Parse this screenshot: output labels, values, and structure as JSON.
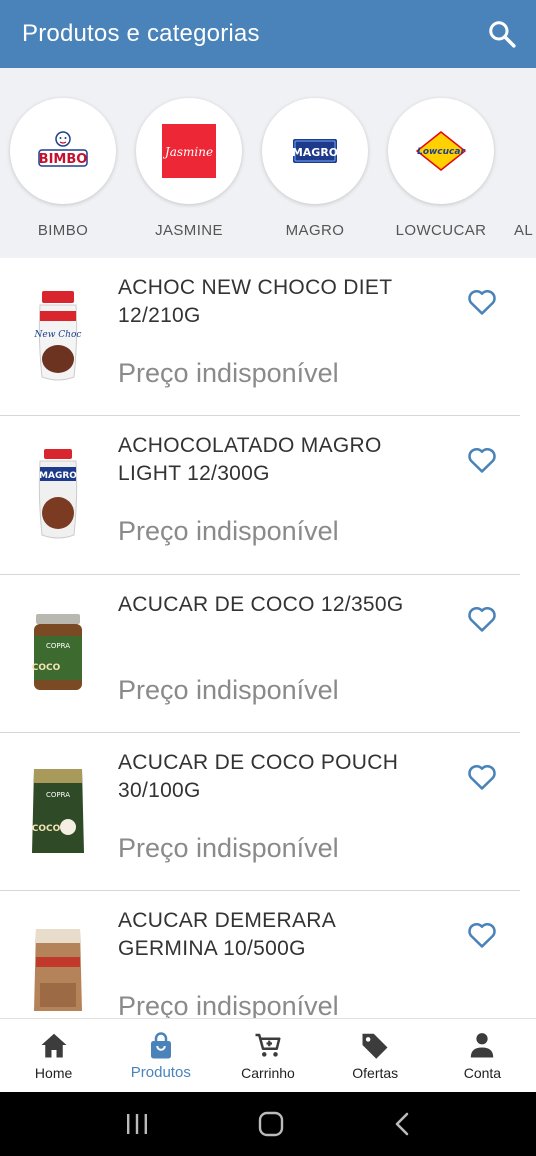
{
  "header": {
    "title": "Produtos e categorias",
    "search_icon": "search-icon"
  },
  "brands": [
    {
      "label": "BIMBO",
      "logo_text": "BIMBO"
    },
    {
      "label": "JASMINE",
      "logo_text": "Jasmine"
    },
    {
      "label": "MAGRO",
      "logo_text": "MAGRO"
    },
    {
      "label": "LOWCUCAR",
      "logo_text": "Lowcucar"
    },
    {
      "label": "AL"
    }
  ],
  "products": [
    {
      "name": "ACHOC NEW CHOCO DIET 12/210G",
      "price": "Preço indisponível"
    },
    {
      "name": "ACHOCOLATADO MAGRO LIGHT 12/300G",
      "price": "Preço indisponível"
    },
    {
      "name": "ACUCAR DE COCO 12/350G",
      "price": "Preço indisponível"
    },
    {
      "name": "ACUCAR DE COCO POUCH 30/100G",
      "price": "Preço indisponível"
    },
    {
      "name": "ACUCAR DEMERARA GERMINA 10/500G",
      "price": "Preço indisponível"
    }
  ],
  "nav": [
    {
      "label": "Home",
      "icon": "home-icon"
    },
    {
      "label": "Produtos",
      "icon": "shopping-bag-icon",
      "active": true
    },
    {
      "label": "Carrinho",
      "icon": "cart-icon"
    },
    {
      "label": "Ofertas",
      "icon": "tag-icon"
    },
    {
      "label": "Conta",
      "icon": "person-icon"
    }
  ],
  "colors": {
    "primary": "#4a83b9",
    "brands_bg": "#f0f1f4",
    "price_gray": "#8a8a8a"
  }
}
